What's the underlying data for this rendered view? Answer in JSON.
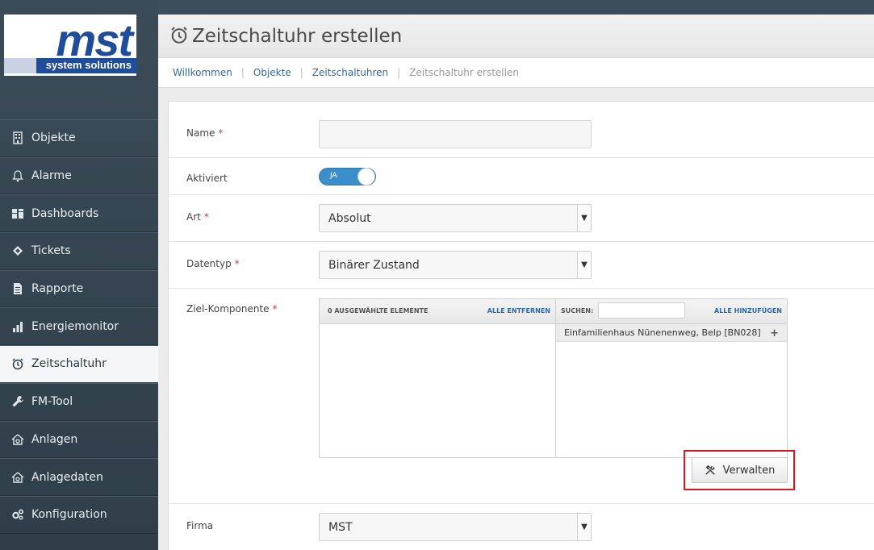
{
  "logo": {
    "brand": "mst",
    "sub": "system solutions"
  },
  "sidebar": {
    "items": [
      {
        "label": "Objekte",
        "icon": "building-icon"
      },
      {
        "label": "Alarme",
        "icon": "bell-icon"
      },
      {
        "label": "Dashboards",
        "icon": "dashboard-icon"
      },
      {
        "label": "Tickets",
        "icon": "ticket-icon"
      },
      {
        "label": "Rapporte",
        "icon": "document-icon"
      },
      {
        "label": "Energiemonitor",
        "icon": "bar-chart-icon"
      },
      {
        "label": "Zeitschaltuhr",
        "icon": "timer-icon",
        "active": true
      },
      {
        "label": "FM-Tool",
        "icon": "wrench-icon"
      },
      {
        "label": "Anlagen",
        "icon": "house-gear-icon"
      },
      {
        "label": "Anlagedaten",
        "icon": "house-gear-icon"
      },
      {
        "label": "Konfiguration",
        "icon": "gears-icon"
      }
    ]
  },
  "header": {
    "title": "Zeitschaltuhr erstellen"
  },
  "breadcrumb": {
    "items": [
      "Willkommen",
      "Objekte",
      "Zeitschaltuhren"
    ],
    "current": "Zeitschaltuhr erstellen"
  },
  "form": {
    "name": {
      "label": "Name",
      "value": ""
    },
    "aktiviert": {
      "label": "Aktiviert",
      "value": "JA"
    },
    "art": {
      "label": "Art",
      "value": "Absolut"
    },
    "datentyp": {
      "label": "Datentyp",
      "value": "Binärer Zustand"
    },
    "ziel": {
      "label": "Ziel-Komponente",
      "selected_header": "0 ausgewählte Elemente",
      "remove_all": "Alle entfernen",
      "search_label": "Suchen:",
      "add_all": "Alle hinzufügen",
      "available": [
        "Einfamilienhaus Nünenenweg, Belp [BN028]"
      ],
      "plus": "+",
      "manage_button": "Verwalten"
    },
    "firma": {
      "label": "Firma",
      "value": "MST"
    }
  },
  "colors": {
    "accent": "#3a8fcb",
    "highlight": "#e0151b",
    "sidebar": "#3b4b57"
  }
}
